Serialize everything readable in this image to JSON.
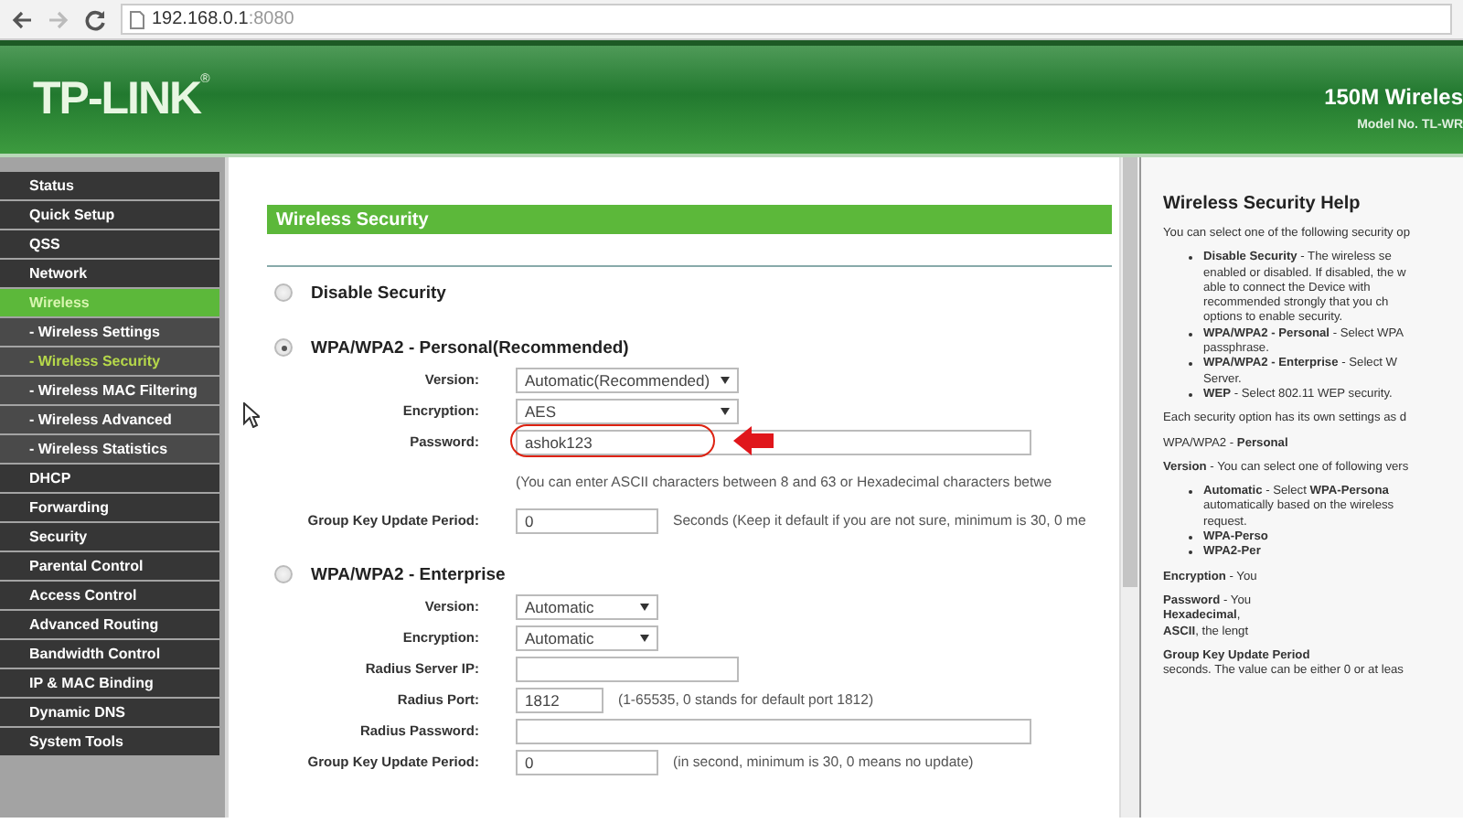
{
  "browser": {
    "url_host": "192.168.0.1",
    "url_port": ":8080"
  },
  "header": {
    "logo": "TP-LINK",
    "logo_mark": "®",
    "product": "150M Wireles",
    "model": "Model No. TL-WR"
  },
  "sidebar": {
    "items": [
      {
        "label": "Status",
        "kind": "main",
        "selected": false
      },
      {
        "label": "Quick Setup",
        "kind": "main",
        "selected": false
      },
      {
        "label": "QSS",
        "kind": "main",
        "selected": false
      },
      {
        "label": "Network",
        "kind": "main",
        "selected": false
      },
      {
        "label": "Wireless",
        "kind": "main",
        "selected": true
      },
      {
        "label": "- Wireless Settings",
        "kind": "sub",
        "selected": false
      },
      {
        "label": "- Wireless Security",
        "kind": "sub",
        "selected": true
      },
      {
        "label": "- Wireless MAC Filtering",
        "kind": "sub",
        "selected": false
      },
      {
        "label": "- Wireless Advanced",
        "kind": "sub",
        "selected": false
      },
      {
        "label": "- Wireless Statistics",
        "kind": "sub",
        "selected": false
      },
      {
        "label": "DHCP",
        "kind": "main",
        "selected": false
      },
      {
        "label": "Forwarding",
        "kind": "main",
        "selected": false
      },
      {
        "label": "Security",
        "kind": "main",
        "selected": false
      },
      {
        "label": "Parental Control",
        "kind": "main",
        "selected": false
      },
      {
        "label": "Access Control",
        "kind": "main",
        "selected": false
      },
      {
        "label": "Advanced Routing",
        "kind": "main",
        "selected": false
      },
      {
        "label": "Bandwidth Control",
        "kind": "main",
        "selected": false
      },
      {
        "label": "IP & MAC Binding",
        "kind": "main",
        "selected": false
      },
      {
        "label": "Dynamic DNS",
        "kind": "main",
        "selected": false
      },
      {
        "label": "System Tools",
        "kind": "main",
        "selected": false
      }
    ]
  },
  "panel": {
    "title": "Wireless Security",
    "sections": [
      {
        "label": "Disable Security",
        "selected": false
      },
      {
        "label": "WPA/WPA2 - Personal(Recommended)",
        "selected": true,
        "fields": [
          {
            "label": "Version:",
            "kind": "select",
            "value": "Automatic(Recommended)"
          },
          {
            "label": "Encryption:",
            "kind": "select",
            "value": "AES"
          },
          {
            "label": "Password:",
            "kind": "input",
            "value": "ashok123",
            "highlighted": true,
            "note_below": "(You can enter ASCII characters between 8 and 63 or Hexadecimal characters betwe"
          },
          {
            "label": "Group Key Update Period:",
            "kind": "input",
            "value": "0",
            "note": "Seconds (Keep it default if you are not sure, minimum is 30, 0 me"
          }
        ]
      },
      {
        "label": "WPA/WPA2 - Enterprise",
        "selected": false,
        "fields": [
          {
            "label": "Version:",
            "kind": "select",
            "value": "Automatic"
          },
          {
            "label": "Encryption:",
            "kind": "select",
            "value": "Automatic"
          },
          {
            "label": "Radius Server IP:",
            "kind": "input"
          },
          {
            "label": "Radius Port:",
            "kind": "input",
            "value": "1812",
            "note": "(1-65535, 0 stands for default port 1812)"
          },
          {
            "label": "Radius Password:",
            "kind": "input"
          },
          {
            "label": "Group Key Update Period:",
            "kind": "input",
            "value": "0",
            "note": "(in second, minimum is 30, 0 means no update)"
          }
        ]
      }
    ]
  },
  "help": {
    "title": "Wireless Security Help",
    "blocks": [
      {
        "kind": "para",
        "lines": [
          "You can select one of the following security op"
        ]
      },
      {
        "kind": "bullets",
        "items": [
          [
            "**Disable Security** - The wireless se",
            "enabled or disabled. If disabled, the w",
            "able to connect the Device with",
            "recommended strongly that you ch",
            "options to enable security."
          ],
          [
            "**WPA/WPA2 - Personal** - Select WPA",
            "passphrase."
          ],
          [
            "**WPA/WPA2 - Enterprise** - Select W",
            "Server."
          ],
          [
            "**WEP** - Select 802.11 WEP security."
          ]
        ]
      },
      {
        "kind": "para",
        "lines": [
          "Each security option has its own settings as d"
        ]
      },
      {
        "kind": "para",
        "lines": [
          "WPA/WPA2 - **Personal**"
        ]
      },
      {
        "kind": "para",
        "lines": [
          "**Version** - You can select one of following vers"
        ]
      },
      {
        "kind": "bullets",
        "items": [
          [
            "**Automatic** - Select **WPA-Persona**",
            "automatically based on the wireless",
            "request."
          ],
          [
            "**WPA-Perso**"
          ],
          [
            "**WPA2-Per**"
          ]
        ]
      },
      {
        "kind": "para",
        "lines": [
          "**Encryption** - You"
        ]
      },
      {
        "kind": "para",
        "lines": [
          "**Password** - You",
          "**Hexadecimal**,",
          "**ASCII**, the lengt"
        ]
      },
      {
        "kind": "para",
        "lines": [
          "**Group Key Update Period**",
          "seconds. The value can be either 0 or at leas"
        ]
      }
    ]
  }
}
